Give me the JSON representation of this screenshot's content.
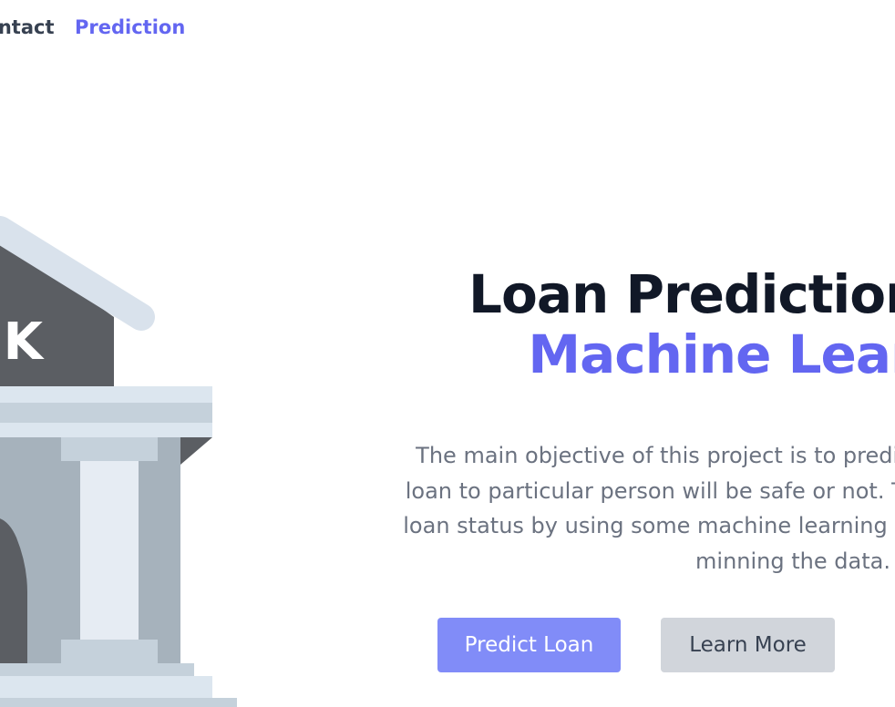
{
  "nav": {
    "items": [
      {
        "label": "Contact"
      },
      {
        "label": "Prediction"
      }
    ]
  },
  "illustration": {
    "sign_text": "BANK"
  },
  "hero": {
    "title_line_1": "Loan Prediction Using",
    "title_line_2": "Machine Learning",
    "description": "The main objective of this project is to predict whether assigning the loan to particular person will be safe or not. This model will predict the loan status by using some machine learning algorithms.This is done by minning the data.",
    "primary_button": "Predict Loan",
    "secondary_button": "Learn More"
  },
  "colors": {
    "accent": "#6366f1",
    "primary_button_bg": "#818cf8",
    "secondary_button_bg": "#d1d5db",
    "title": "#111827",
    "body_text": "#6b7280"
  }
}
